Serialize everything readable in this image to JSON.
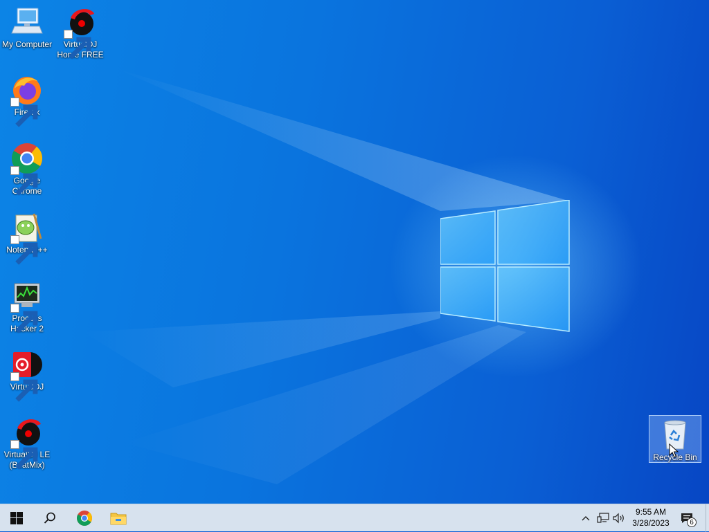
{
  "desktop": {
    "icons": [
      {
        "label": "My Computer",
        "icon": "computer-icon"
      },
      {
        "label": "VirtualDJ Home FREE",
        "icon": "virtualdj-home-icon"
      },
      {
        "label": "Firefox",
        "icon": "firefox-icon"
      },
      {
        "label": "Google Chrome",
        "icon": "chrome-icon"
      },
      {
        "label": "Notepad++",
        "icon": "notepadpp-icon"
      },
      {
        "label": "Process Hacker 2",
        "icon": "process-hacker-icon"
      },
      {
        "label": "VirtualDJ",
        "icon": "virtualdj-icon"
      },
      {
        "label": "VirtualDJ LE (BeatMix)",
        "icon": "virtualdj-le-icon"
      },
      {
        "label": "Recycle Bin",
        "icon": "recycle-bin-icon",
        "selected": true
      }
    ]
  },
  "taskbar": {
    "start": {
      "icon": "windows-start-icon"
    },
    "search": {
      "icon": "search-icon"
    },
    "pinned": [
      {
        "name": "Google Chrome",
        "icon": "chrome-icon"
      },
      {
        "name": "File Explorer",
        "icon": "file-explorer-icon"
      }
    ],
    "tray": {
      "icons": [
        "chevron-up-icon",
        "network-icon",
        "volume-icon"
      ],
      "time": "9:55 AM",
      "date": "3/28/2023",
      "notifications": {
        "icon": "action-center-icon",
        "count": "6"
      }
    }
  },
  "colors": {
    "accent": "#0a74de",
    "taskbar": "#d7e2ee"
  }
}
